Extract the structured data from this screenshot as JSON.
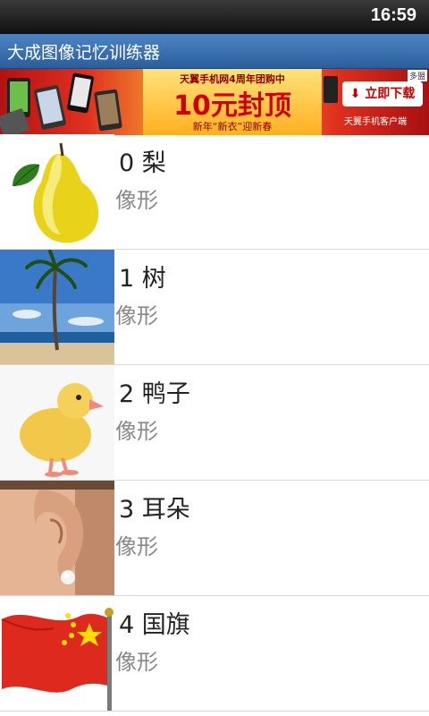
{
  "status": {
    "time": "16:59"
  },
  "app": {
    "title": "大成图像记忆训练器"
  },
  "ad": {
    "top": "天翼手机网4周年团购中",
    "headline": "10元封顶",
    "sub": "新年“新衣”迎新春",
    "button": "立即下载",
    "client": "天翼手机客户端",
    "tag": "多盟"
  },
  "items": [
    {
      "title": "0 梨",
      "sub": "像形",
      "icon": "pear-image"
    },
    {
      "title": "1 树",
      "sub": "像形",
      "icon": "palm-tree-image"
    },
    {
      "title": "2 鸭子",
      "sub": "像形",
      "icon": "duckling-image"
    },
    {
      "title": "3 耳朵",
      "sub": "像形",
      "icon": "ear-image"
    },
    {
      "title": "4 国旗",
      "sub": "像形",
      "icon": "flag-image"
    }
  ]
}
